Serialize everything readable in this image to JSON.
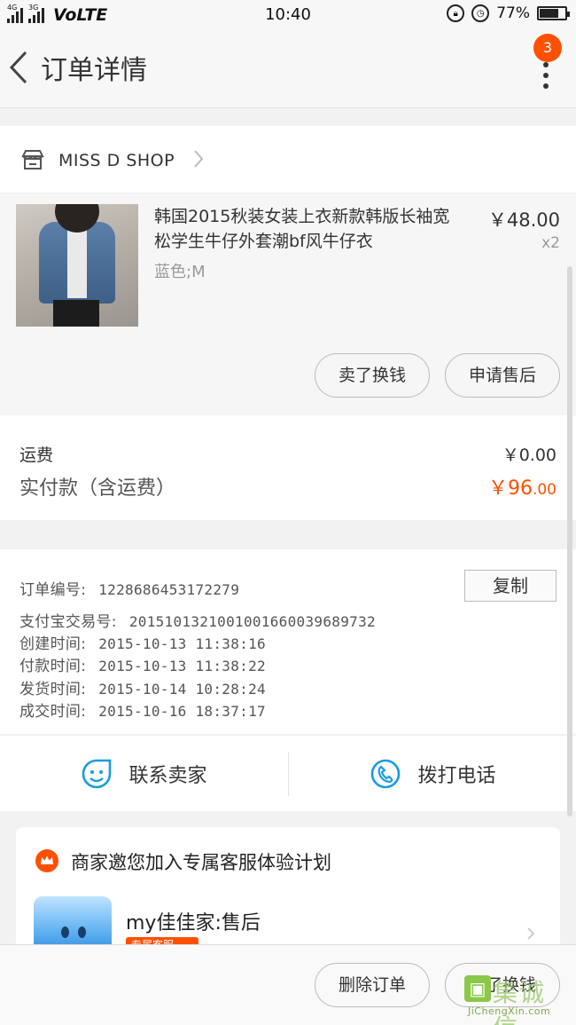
{
  "status_bar": {
    "net1": "4G",
    "net2": "3G",
    "volte": "VoLTE",
    "time": "10:40",
    "battery": "77%",
    "battery_level": 0.77
  },
  "nav": {
    "title": "订单详情",
    "badge": "3"
  },
  "shop": {
    "name": "MISS D SHOP"
  },
  "item": {
    "title": "韩国2015秋装女装上衣新款韩版长袖宽松学生牛仔外套潮bf风牛仔衣",
    "spec": "蓝色;M",
    "price": "￥48.00",
    "qty": "x2",
    "actions": [
      "卖了换钱",
      "申请售后"
    ]
  },
  "fee": {
    "shipping_label": "运费",
    "shipping_value": "￥0.00",
    "paid_label": "实付款（含运费）",
    "paid_int": "￥96",
    "paid_dec": ".00"
  },
  "order_info": {
    "copy_label": "复制",
    "rows": [
      {
        "label": "订单编号:",
        "value": "1228686453172279"
      },
      {
        "label": "支付宝交易号:",
        "value": "2015101321001001660039689732"
      },
      {
        "label": "创建时间:",
        "value": "2015-10-13 11:38:16"
      },
      {
        "label": "付款时间:",
        "value": "2015-10-13 11:38:22"
      },
      {
        "label": "发货时间:",
        "value": "2015-10-14 10:28:24"
      },
      {
        "label": "成交时间:",
        "value": "2015-10-16 18:37:17"
      }
    ]
  },
  "contact": {
    "seller": "联系卖家",
    "phone": "拨打电话"
  },
  "invite": {
    "title": "商家邀您加入专属客服体验计划",
    "service_name": "my佳佳家:售后",
    "tag": "专属客服"
  },
  "bottom": {
    "actions": [
      "删除订单",
      "卖了换钱"
    ]
  },
  "watermark": {
    "cn": "集诚信",
    "en": "JiChengXin.com"
  },
  "colors": {
    "accent": "#ff5000",
    "icon_blue": "#1a9be0"
  }
}
